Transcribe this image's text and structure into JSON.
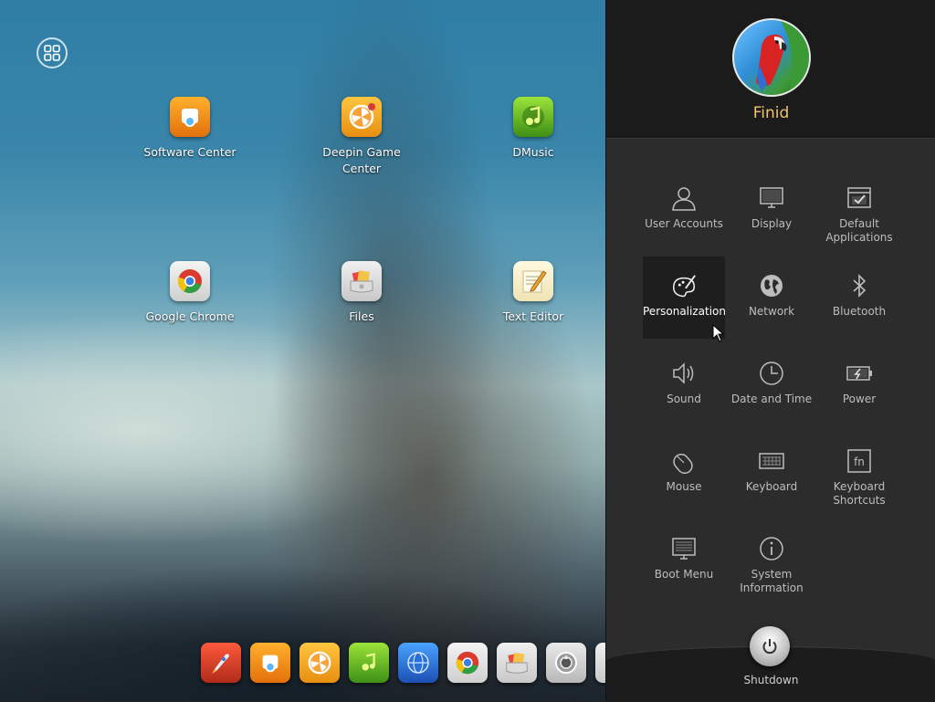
{
  "desktop": {
    "apps": [
      {
        "label": "Software Center",
        "icon": "software-center-icon"
      },
      {
        "label": "Deepin Game Center",
        "icon": "game-center-icon"
      },
      {
        "label": "DMusic",
        "icon": "dmusic-icon"
      },
      {
        "label": "Google Chrome",
        "icon": "chrome-icon"
      },
      {
        "label": "Files",
        "icon": "files-icon"
      },
      {
        "label": "Text Editor",
        "icon": "text-editor-icon"
      }
    ],
    "dock": [
      {
        "icon": "launcher-rocket-icon"
      },
      {
        "icon": "software-center-icon"
      },
      {
        "icon": "game-center-icon"
      },
      {
        "icon": "dmusic-icon"
      },
      {
        "icon": "browser-globe-icon"
      },
      {
        "icon": "chrome-icon"
      },
      {
        "icon": "files-icon"
      },
      {
        "icon": "system-settings-icon"
      }
    ]
  },
  "panel": {
    "username": "Finid",
    "modules": [
      {
        "label": "User Accounts",
        "icon": "user-icon"
      },
      {
        "label": "Display",
        "icon": "monitor-icon"
      },
      {
        "label": "Default Applications",
        "icon": "checkbox-window-icon"
      },
      {
        "label": "Personalization",
        "icon": "palette-icon"
      },
      {
        "label": "Network",
        "icon": "globe-icon"
      },
      {
        "label": "Bluetooth",
        "icon": "bluetooth-icon"
      },
      {
        "label": "Sound",
        "icon": "speaker-icon"
      },
      {
        "label": "Date and Time",
        "icon": "clock-icon"
      },
      {
        "label": "Power",
        "icon": "battery-icon"
      },
      {
        "label": "Mouse",
        "icon": "mouse-icon"
      },
      {
        "label": "Keyboard",
        "icon": "keyboard-icon"
      },
      {
        "label": "Keyboard Shortcuts",
        "icon": "fn-key-icon"
      },
      {
        "label": "Boot Menu",
        "icon": "boot-menu-icon"
      },
      {
        "label": "System Information",
        "icon": "info-icon"
      }
    ],
    "active_module": "Personalization",
    "shutdown_label": "Shutdown"
  }
}
